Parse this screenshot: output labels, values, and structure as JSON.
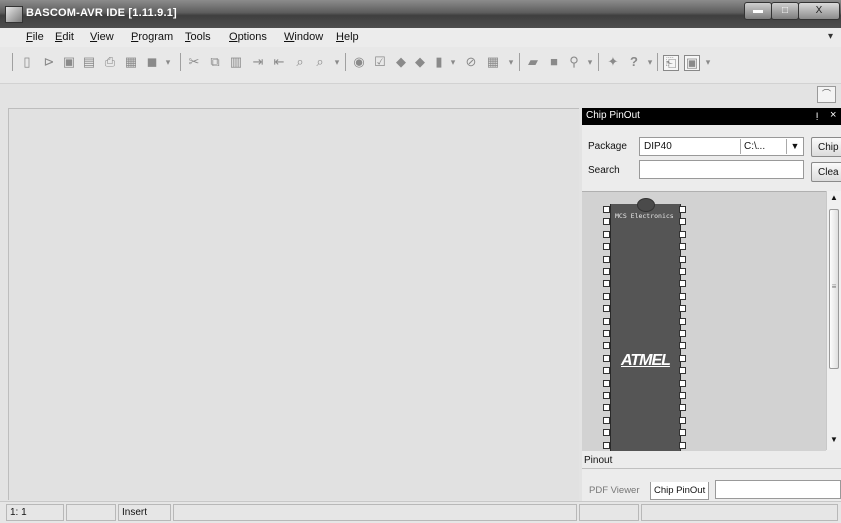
{
  "window": {
    "title": "BASCOM-AVR IDE [1.11.9.1]",
    "minimize_glyph": "▬",
    "maximize_glyph": "□",
    "close_glyph": "X"
  },
  "menu": {
    "items": [
      {
        "prefix": "",
        "u": "F",
        "rest": "ile"
      },
      {
        "prefix": "",
        "u": "E",
        "rest": "dit"
      },
      {
        "prefix": "",
        "u": "V",
        "rest": "iew"
      },
      {
        "prefix": "",
        "u": "P",
        "rest": "rogram"
      },
      {
        "prefix": "",
        "u": "T",
        "rest": "ools"
      },
      {
        "prefix": "",
        "u": "O",
        "rest": "ptions"
      },
      {
        "prefix": "",
        "u": "W",
        "rest": "indow"
      },
      {
        "prefix": "",
        "u": "H",
        "rest": "elp"
      }
    ],
    "more_glyph": "▾"
  },
  "toolbar": {
    "icons": [
      "new-file",
      "open-file",
      "save-file",
      "save-all",
      "print",
      "print-preview",
      "close-file",
      "separator",
      "cut",
      "copy",
      "paste",
      "indent",
      "unindent",
      "find",
      "find-next",
      "separator",
      "compile",
      "syntax-check",
      "program-chip",
      "program-chip-2",
      "terminal",
      "simulate",
      "stop",
      "separator",
      "lcd-designer",
      "bar",
      "chip-select",
      "separator",
      "help",
      "question",
      "separator",
      "pdf-viewer",
      "chip-pinout"
    ]
  },
  "chip_pinout": {
    "title": "Chip PinOut",
    "pin_glyph": "ᴉ",
    "close_glyph": "×",
    "package_label": "Package",
    "package_value": "DIP40",
    "path_value": "C:\\...",
    "chip_button": "Chip",
    "search_label": "Search",
    "search_value": "",
    "clear_button": "Clea",
    "chip_text": "MCS Electronics",
    "chip_logo": "ATMEL",
    "pinout_label": "Pinout",
    "tabs": [
      "PDF Viewer",
      "Chip PinOut"
    ]
  },
  "status": {
    "position": "1: 1",
    "mode": "Insert"
  }
}
